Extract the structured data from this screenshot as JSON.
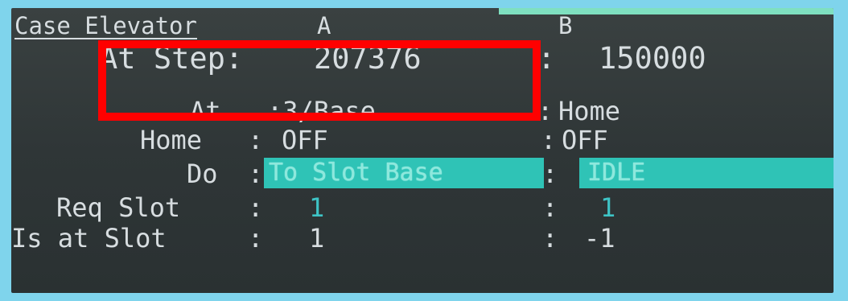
{
  "panel": {
    "title": "Case Elevator",
    "col_a": "A",
    "col_b": "B"
  },
  "rows": {
    "at_step": {
      "label": "At Step:",
      "a": "207376",
      "sep": ":",
      "b": "150000"
    },
    "at": {
      "label": "At",
      "a": ":3/Base",
      "sep": ":",
      "b": "Home"
    },
    "home": {
      "label": "Home",
      "sep_a": ":",
      "a": "OFF",
      "sep": ":",
      "b": "OFF"
    },
    "do": {
      "label": "Do",
      "sep_a": ":",
      "a": "To Slot Base",
      "sep": ":",
      "b": "IDLE"
    },
    "req_slot": {
      "label": "Req Slot",
      "sep_a": ":",
      "a": "1",
      "sep": ":",
      "b": "1"
    },
    "is_at_slot": {
      "label": "Is at Slot",
      "sep_a": ":",
      "a": "1",
      "sep": ":",
      "b": "-1"
    }
  },
  "colors": {
    "screen_bg": "#2f3637",
    "text": "#d7dde0",
    "accent": "#3ec4c6",
    "highlight": "#2fc3b6",
    "callout": "#ff0000",
    "frame": "#7fd4ec"
  }
}
